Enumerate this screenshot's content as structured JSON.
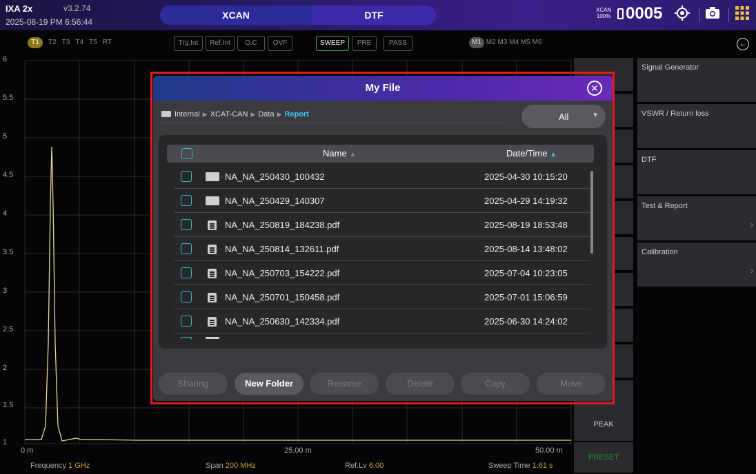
{
  "top_bar": {
    "model": "IXA 2x",
    "version": "v3.2.74",
    "datetime": "2025-08-19 PM 6:56:44",
    "modes": [
      "XCAN",
      "DTF"
    ],
    "xcan_badge": [
      "XCAN",
      "100%"
    ],
    "counter": "0005"
  },
  "traces": [
    "T1",
    "T2",
    "T3",
    "T4",
    "T5",
    "RT"
  ],
  "status_buttons": [
    "Trg.Int",
    "Ref.Int",
    "O.C",
    "OVF",
    "SWEEP",
    "PRE",
    "PASS"
  ],
  "markers": [
    "M1",
    "M2",
    "M3",
    "M4",
    "M5",
    "M6"
  ],
  "graph": {
    "y_ticks": [
      "6",
      "5.5",
      "5",
      "4.5",
      "4",
      "3.5",
      "3",
      "2.5",
      "2",
      "1.5",
      "1"
    ],
    "x_ticks": [
      "0 m",
      "25.00 m",
      "50.00 m"
    ],
    "trace_color": "#e8d890"
  },
  "footer": {
    "frequency_label": "Frequency",
    "frequency_value": "1 GHz",
    "span_label": "Span",
    "span_value": "200 MHz",
    "reflv_label": "Ref.Lv",
    "reflv_value": "6.00",
    "sweep_label": "Sweep Time",
    "sweep_value": "1.61 s"
  },
  "soft_keys": {
    "peak": "PEAK",
    "preset": "PRESET"
  },
  "right_menu": [
    "Signal Generator",
    "VSWR / Return loss",
    "DTF",
    "Test & Report",
    "Calibration"
  ],
  "modal": {
    "title": "My File",
    "breadcrumb": [
      "Internal",
      "XCAT-CAN",
      "Data",
      "Report"
    ],
    "filter_value": "All",
    "col_name": "Name",
    "col_date": "Date/Time",
    "files": [
      {
        "type": "folder",
        "name": "NA_NA_250430_100432",
        "date": "2025-04-30 10:15:20"
      },
      {
        "type": "folder",
        "name": "NA_NA_250429_140307",
        "date": "2025-04-29 14:19:32"
      },
      {
        "type": "pdf",
        "name": "NA_NA_250819_184238.pdf",
        "date": "2025-08-19 18:53:48"
      },
      {
        "type": "pdf",
        "name": "NA_NA_250814_132611.pdf",
        "date": "2025-08-14 13:48:02"
      },
      {
        "type": "pdf",
        "name": "NA_NA_250703_154222.pdf",
        "date": "2025-07-04 10:23:05"
      },
      {
        "type": "pdf",
        "name": "NA_NA_250701_150458.pdf",
        "date": "2025-07-01 15:06:59"
      },
      {
        "type": "pdf",
        "name": "NA_NA_250630_142334.pdf",
        "date": "2025-06-30 14:24:02"
      }
    ],
    "actions": [
      "Sharing",
      "New Folder",
      "Rename",
      "Delete",
      "Copy",
      "Move"
    ]
  },
  "colors": {
    "highlight": "#e61b1b",
    "accent": "#3ac8f0",
    "checkbox": "#3ab8b8"
  }
}
